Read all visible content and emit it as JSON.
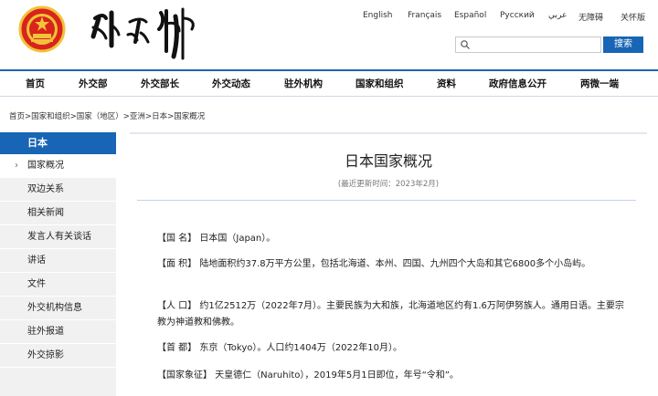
{
  "header": {
    "languages": [
      "English",
      "Français",
      "Español",
      "Русский",
      "عربي",
      "无障碍",
      "关怀版"
    ],
    "search_button": "搜索",
    "search_placeholder": ""
  },
  "nav": [
    "首页",
    "外交部",
    "外交部长",
    "外交动态",
    "驻外机构",
    "国家和组织",
    "资料",
    "政府信息公开",
    "两微一端"
  ],
  "breadcrumb": [
    "首页",
    "国家和组织",
    "国家（地区）",
    "亚洲",
    "日本",
    "国家概况"
  ],
  "sidebar": {
    "title": "日本",
    "items": [
      "国家概况",
      "双边关系",
      "相关新闻",
      "发言人有关谈话",
      "讲话",
      "文件",
      "外交机构信息",
      "驻外报道",
      "外交掠影"
    ],
    "active_index": 0
  },
  "article": {
    "title": "日本国家概况",
    "updated": "(最近更新时间：2023年2月)",
    "paragraphs": [
      {
        "label": "【国 名】",
        "text": "日本国（Japan）。"
      },
      {
        "label": "【面 积】",
        "text": "陆地面积约37.8万平方公里，包括北海道、本州、四国、九州四个大岛和其它6800多个小岛屿。"
      },
      {
        "label": "【人 口】",
        "text": "约1亿2512万（2022年7月）。主要民族为大和族，北海道地区约有1.6万阿伊努族人。通用日语。主要宗教为神道教和佛教。"
      },
      {
        "label": "【首 都】",
        "text": "东京（Tokyo）。人口约1404万（2022年10月）。"
      },
      {
        "label": "【国家象征】",
        "text": "天皇德仁（Naruhito），2019年5月1日即位，年号“令和”。"
      }
    ]
  },
  "colors": {
    "accent": "#1865b5",
    "emblem_red": "#d8241c",
    "emblem_gold": "#f2c23a"
  },
  "icons": {
    "emblem": "national-emblem-icon",
    "calligraphy": "ministry-calligraphy-logo",
    "search": "search-icon",
    "arrow": "chevron-right-icon"
  }
}
